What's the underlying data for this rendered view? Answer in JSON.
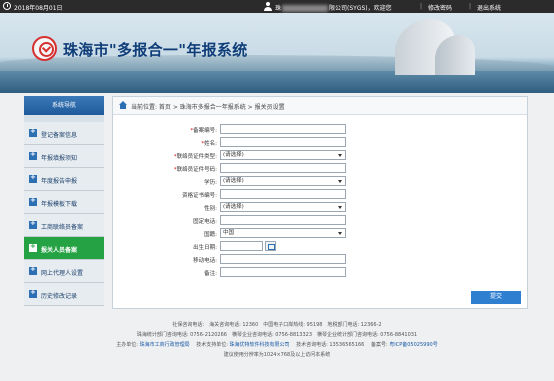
{
  "topbar": {
    "date": "2018年08月01日",
    "user_prefix": "珠",
    "user_suffix": "限公司(SYGS)，欢迎您",
    "change_password": "修改密码",
    "logout": "退出系统",
    "separator": "|"
  },
  "banner": {
    "title": "珠海市\"多报合一\"年报系统"
  },
  "sidebar": {
    "header": "系统导航",
    "items": [
      {
        "label": "登记备案信息"
      },
      {
        "label": "年报填报须知"
      },
      {
        "label": "年度报告申报"
      },
      {
        "label": "年报模板下载"
      },
      {
        "label": "工商联络员备案"
      },
      {
        "label": "报关人员备案"
      },
      {
        "label": "网上代理人设置"
      },
      {
        "label": "历史修改记录"
      }
    ],
    "active_index": 5
  },
  "breadcrumb": {
    "text": "当前位置: 首页 > 珠海市多报合一年报系统 > 报关员设置"
  },
  "form": {
    "fields": [
      {
        "label": "备案编号:",
        "required": true,
        "value": ""
      },
      {
        "label": "姓名:",
        "required": true,
        "value": ""
      },
      {
        "label": "联络员证件类型:",
        "required": true,
        "value": "(请选择)"
      },
      {
        "label": "联络员证件号码:",
        "required": true,
        "value": ""
      },
      {
        "label": "学历:",
        "required": false,
        "value": "(请选择)"
      },
      {
        "label": "资格证书编号:",
        "required": false,
        "value": ""
      },
      {
        "label": "性别:",
        "required": false,
        "value": "(请选择)"
      },
      {
        "label": "固定电话:",
        "required": false,
        "value": ""
      },
      {
        "label": "国籍:",
        "required": false,
        "value": "中国"
      },
      {
        "label": "出生日期:",
        "required": false,
        "value": ""
      },
      {
        "label": "移动电话:",
        "required": false,
        "value": ""
      },
      {
        "label": "备注:",
        "required": false,
        "value": ""
      }
    ],
    "required_mark": "*",
    "submit_label": "提交"
  },
  "footer": {
    "line1": "社保咨询电话:　海关咨询电话: 12360　中国电子口岸热线: 95198　地税部门电话: 12366-2",
    "line2": "珠海统计部门咨询电话: 0756-2120266　横琴企业咨询电话: 0756-8813323　横琴企业统计部门咨询电话: 0756-8841031",
    "line3_label1": "主办单位:",
    "line3_org1": "珠海市工商行政管理局",
    "line3_label2": "技术支持单位:",
    "line3_org2": "珠海优特软件科技有限公司",
    "line3_label3": "技术咨询电话: 13536565166",
    "line3_label4": "备案号:",
    "line3_icp": "粤ICP备05025990号",
    "line4": "建议使用分辨率为1024×768及以上访问本系统"
  },
  "colors": {
    "topbar_bg": "#2b2b2b",
    "sidebar_header": "#1f5b9c",
    "active_item": "#25a244",
    "submit_button": "#2f7fd0",
    "required": "#d20000"
  }
}
